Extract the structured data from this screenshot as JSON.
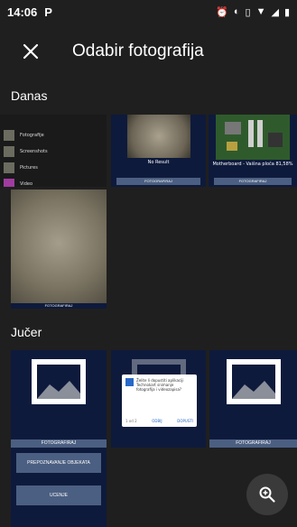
{
  "status": {
    "time": "14:06",
    "carrier_icon": "P"
  },
  "app_bar": {
    "title": "Odabir fotografija",
    "close_icon": "close-icon"
  },
  "sections": {
    "today": "Danas",
    "yesterday": "Jučer"
  },
  "today_thumbs": {
    "list": [
      {
        "label": "Fotografije"
      },
      {
        "label": "Screenshots"
      },
      {
        "label": "Pictures"
      },
      {
        "label": "Video"
      }
    ],
    "no_result": {
      "caption": "No Result",
      "button": "FOTOGRAFIRAJ"
    },
    "motherboard": {
      "caption": "Motherboard - Vaišna ploča 81,58%",
      "button": "FOTOGRAFIRAJ"
    },
    "wall": {
      "caption": "FOTOGRAFIRAJ"
    }
  },
  "yesterday_thumbs": {
    "j1_button": "FOTOGRAFIRAJ",
    "j3_button": "FOTOGRAFIRAJ",
    "dialog": {
      "text": "Želite li dopustiti aplikaciji Technokart snimanje fotografija i videozapisa?",
      "counter": "1 od 2",
      "deny": "ODBIJ",
      "allow": "DOPUSTI"
    },
    "menu": [
      "PREPOZNAVANJE OBJEKATA",
      "UCENJE"
    ]
  },
  "fab": {
    "icon": "zoom-in-icon"
  },
  "colors": {
    "background": "#1f1f1f",
    "tile": "#0e1a3c",
    "button": "#4b5f82"
  }
}
